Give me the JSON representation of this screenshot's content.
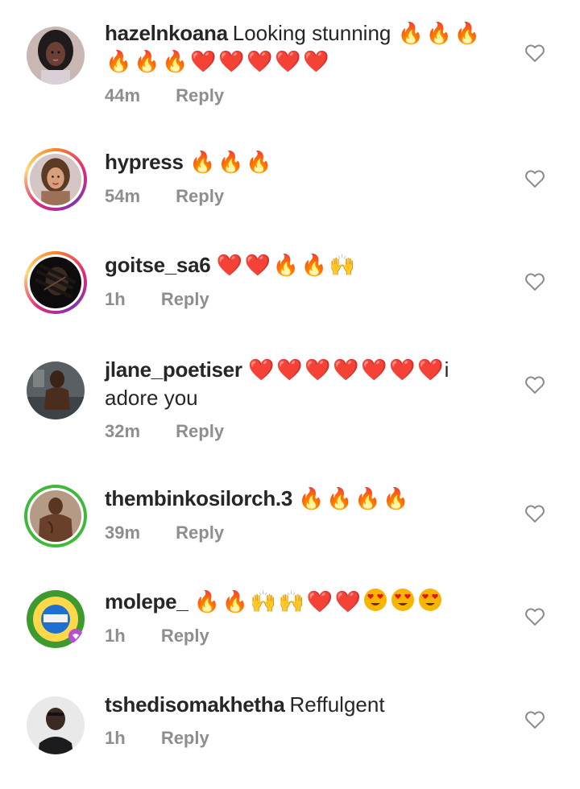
{
  "comments": [
    {
      "username": "hazelnkoana",
      "text": "Looking stunning",
      "emojis": [
        "🔥",
        "🔥",
        "🔥",
        "🔥",
        "🔥",
        "🔥",
        "❤️",
        "❤️",
        "❤️",
        "❤️",
        "❤️"
      ],
      "time": "44m",
      "reply_label": "Reply",
      "avatar_ring": "none"
    },
    {
      "username": "hypress",
      "text": "",
      "emojis": [
        "🔥",
        "🔥",
        "🔥"
      ],
      "time": "54m",
      "reply_label": "Reply",
      "avatar_ring": "story"
    },
    {
      "username": "goitse_sa6",
      "text": "",
      "emojis": [
        "❤️",
        "❤️",
        "🔥",
        "🔥",
        "🙌"
      ],
      "time": "1h",
      "reply_label": "Reply",
      "avatar_ring": "story"
    },
    {
      "username": "jlane_poetiser",
      "text_after": "i adore you",
      "emojis": [
        "❤️",
        "❤️",
        "❤️",
        "❤️",
        "❤️",
        "❤️",
        "❤️"
      ],
      "time": "32m",
      "reply_label": "Reply",
      "avatar_ring": "none"
    },
    {
      "username": "thembinkosilorch.3",
      "text": "",
      "emojis": [
        "🔥",
        "🔥",
        "🔥",
        "🔥"
      ],
      "time": "39m",
      "reply_label": "Reply",
      "avatar_ring": "close"
    },
    {
      "username": "molepe_",
      "text": "",
      "emojis": [
        "🔥",
        "🔥",
        "🙌",
        "🙌",
        "❤️",
        "❤️",
        "😍",
        "😍",
        "😍"
      ],
      "time": "1h",
      "reply_label": "Reply",
      "avatar_ring": "none"
    },
    {
      "username": "tshedisomakhetha",
      "text": "Reffulgent",
      "emojis": [],
      "time": "1h",
      "reply_label": "Reply",
      "avatar_ring": "none"
    }
  ],
  "avatar_texts": {
    "molepe_": "LET'S GET VACCINATED"
  },
  "colors": {
    "text": "#262626",
    "meta": "#8e8e8e",
    "fire": "#f5820b",
    "heart": "#e1131e",
    "close_friends_ring": "#3fb93a"
  },
  "icons": {
    "like": "heart-outline-icon"
  }
}
